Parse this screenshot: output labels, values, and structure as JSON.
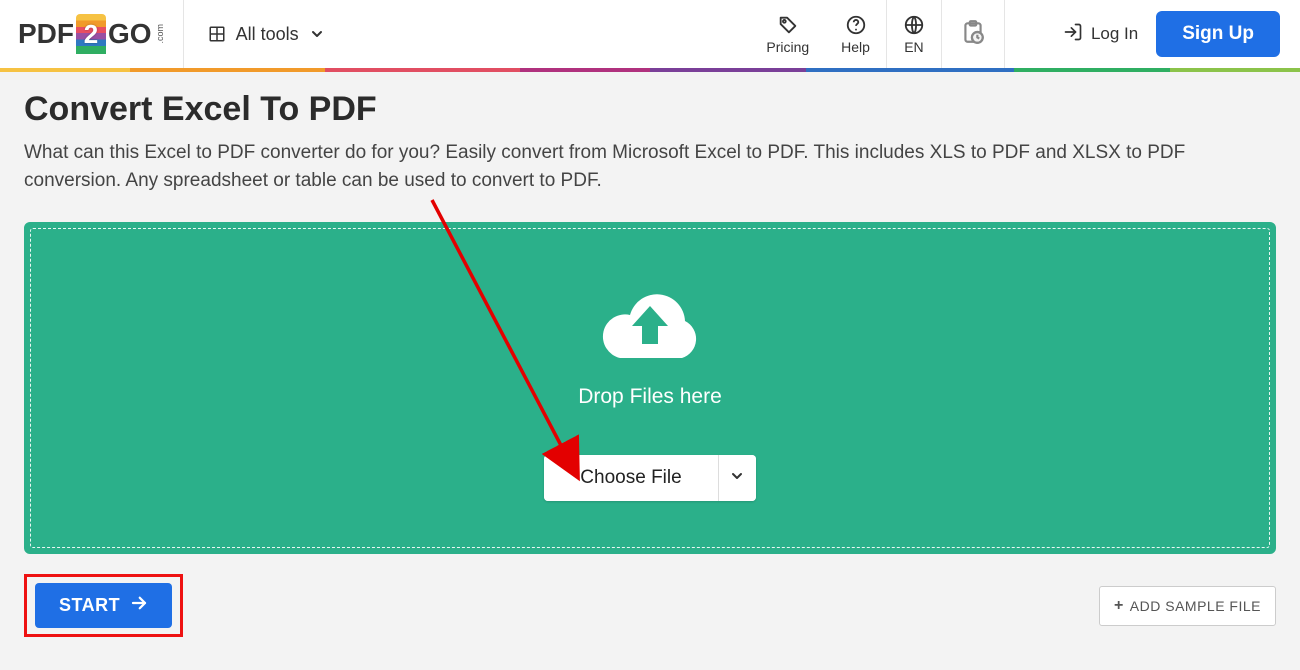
{
  "brand": {
    "left": "PDF",
    "right": "GO",
    "tld": ".com"
  },
  "nav": {
    "all_tools": "All tools",
    "pricing": "Pricing",
    "help": "Help",
    "lang": "EN",
    "login": "Log In",
    "signup": "Sign Up"
  },
  "page": {
    "title": "Convert Excel To PDF",
    "subtitle": "What can this Excel to PDF converter do for you? Easily convert from Microsoft Excel to PDF. This includes XLS to PDF and XLSX to PDF conversion. Any spreadsheet or table can be used to convert to PDF."
  },
  "dropzone": {
    "hint": "Drop Files here",
    "choose": "Choose File"
  },
  "actions": {
    "start": "START",
    "add_sample": "ADD SAMPLE FILE"
  },
  "colors": {
    "accent_green": "#2bb08a",
    "accent_blue": "#1f6fe5",
    "highlight_red": "#ee1111"
  }
}
